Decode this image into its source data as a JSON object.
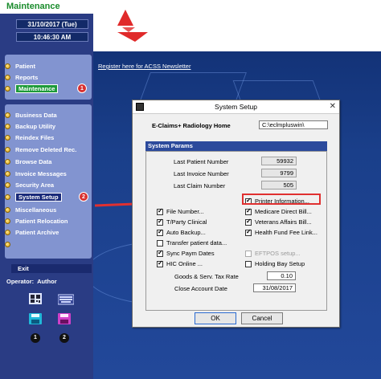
{
  "sidebar": {
    "title": "Maintenance",
    "date": "31/10/2017 (Tue)",
    "time": "10:46:30 AM",
    "top_items": [
      {
        "label": "Patient"
      },
      {
        "label": "Reports"
      },
      {
        "label": "Maintenance",
        "badge": "1"
      }
    ],
    "menu_items": [
      {
        "label": "Business Data"
      },
      {
        "label": "Backup Utility"
      },
      {
        "label": "Reindex Files"
      },
      {
        "label": "Remove Deleted Rec."
      },
      {
        "label": "Browse Data"
      },
      {
        "label": "Invoice Messages"
      },
      {
        "label": "Security Area"
      },
      {
        "label": "System Setup",
        "badge": "2"
      },
      {
        "label": "Miscellaneous"
      },
      {
        "label": "Patient Relocation"
      },
      {
        "label": "Patient Archive"
      },
      {
        "label": ""
      }
    ],
    "exit_label": "Exit",
    "operator_label": "Operator:",
    "operator_name": "Author",
    "icon_numbers": [
      "1",
      "2"
    ]
  },
  "main": {
    "register_link": "Register here for ACSS Newsletter"
  },
  "dialog": {
    "title": "System Setup",
    "eclaims_label": "E-Claims+ Radiology Home",
    "eclaims_value": "C:\\eclmpluswin\\",
    "section_header": "System Params",
    "last_patient_label": "Last Patient Number",
    "last_patient_value": "59932",
    "last_invoice_label": "Last Invoice Number",
    "last_invoice_value": "9799",
    "last_claim_label": "Last Claim Number",
    "last_claim_value": "505",
    "left_checks": [
      {
        "label": "File Number...",
        "checked": true
      },
      {
        "label": "T/Party Clinical",
        "checked": true
      },
      {
        "label": "Auto Backup...",
        "checked": true
      },
      {
        "label": "Transfer patient data...",
        "checked": false
      },
      {
        "label": "Sync Paym Dates",
        "checked": true
      },
      {
        "label": "HIC Online ...",
        "checked": true
      }
    ],
    "right_checks": [
      {
        "label": "Printer Information...",
        "checked": true
      },
      {
        "label": "Medicare Direct Bill...",
        "checked": true
      },
      {
        "label": "Veterans Affairs Bill...",
        "checked": true
      },
      {
        "label": "Health Fund Fee Link...",
        "checked": true
      },
      {
        "label": "EFTPOS setup...",
        "checked": false
      },
      {
        "label": "Holding Bay Setup",
        "checked": false
      }
    ],
    "tax_label": "Goods & Serv. Tax Rate",
    "tax_value": "0.10",
    "close_label": "Close Account Date",
    "close_value": "31/08/2017",
    "ok_label": "OK",
    "cancel_label": "Cancel"
  },
  "colors": {
    "sidebar_bg": "#2a3c84",
    "panel_bg": "#8294d0",
    "accent_green": "#1a8c2c",
    "highlight_red": "#e03030"
  }
}
